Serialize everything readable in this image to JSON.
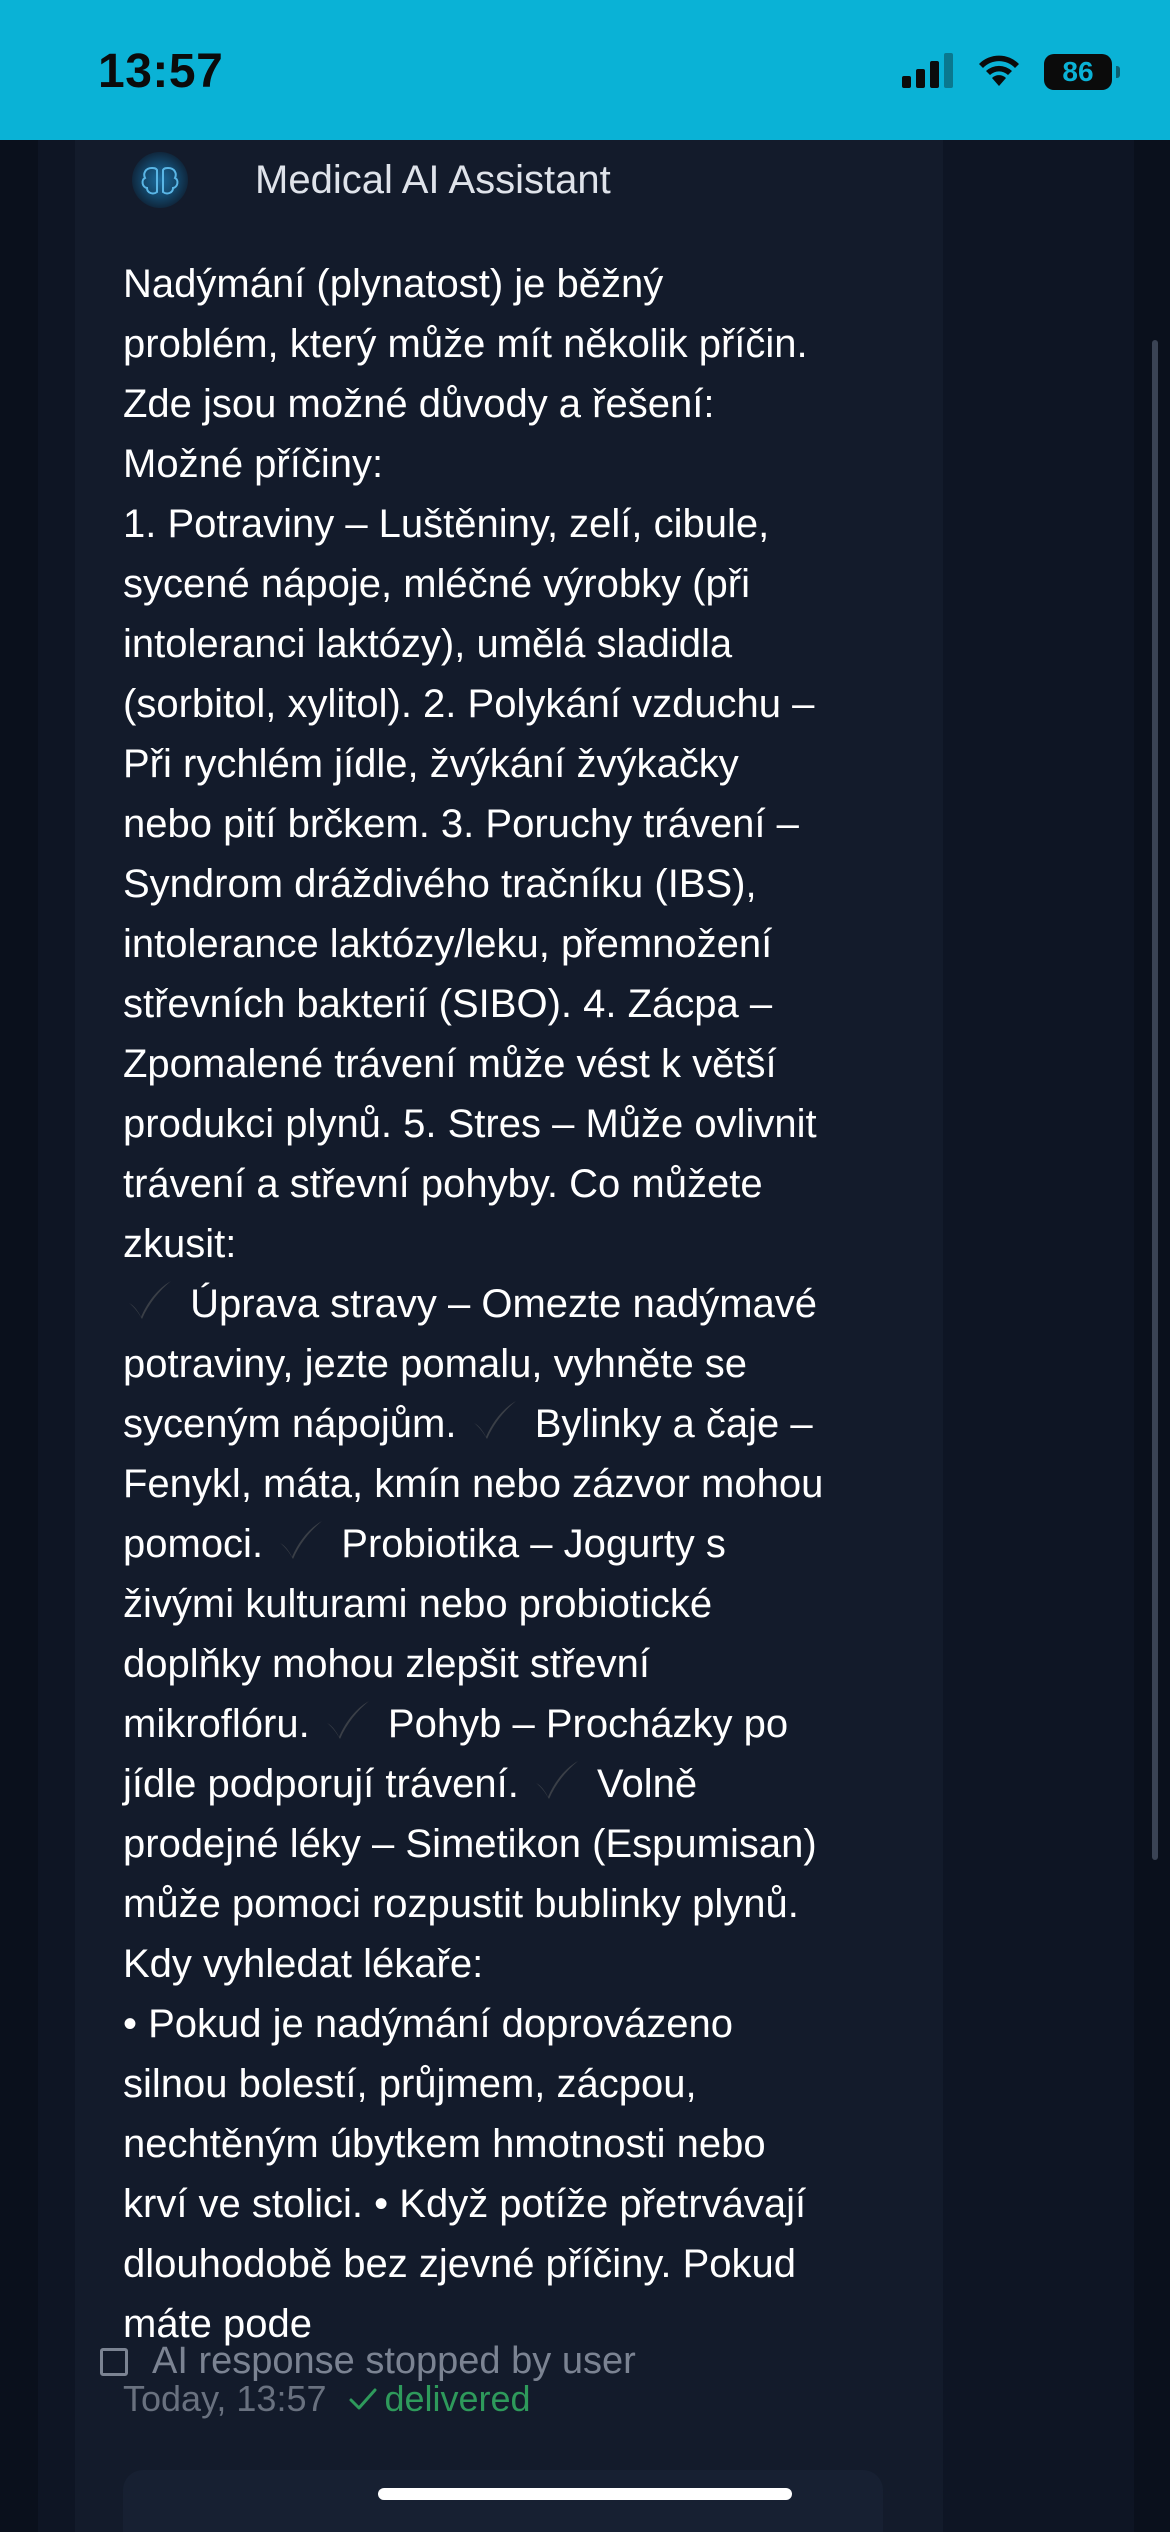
{
  "status_bar": {
    "time": "13:57",
    "battery": "86",
    "background": "#0ab2d6"
  },
  "chat": {
    "sender": "Medical AI Assistant",
    "avatar_icon": "brain-icon",
    "message_lines": [
      "Nadýmání (plynatost) je běžný",
      "problém, který může mít několik příčin.",
      "Zde jsou možné důvody a řešení:",
      "Možné příčiny:",
      "1. Potraviny – Luštěniny, zelí, cibule,",
      "sycené nápoje, mléčné výrobky (při",
      "intoleranci laktózy), umělá sladidla",
      "(sorbitol, xylitol). 2. Polykání vzduchu –",
      "Při rychlém jídle, žvýkání žvýkačky",
      "nebo pití brčkem. 3. Poruchy trávení –",
      "Syndrom dráždivého tračníku (IBS),",
      "intolerance laktózy/leku, přemnožení",
      "střevních bakterií (SIBO). 4. Zácpa –",
      "Zpomalené trávení může vést k větší",
      "produkci plynů. 5. Stres – Může ovlivnit",
      "trávení a střevní pohyby. Co můžete",
      "zkusit:",
      [
        {
          "icon": true
        },
        " Úprava stravy – Omezte nadýmavé"
      ],
      "potraviny, jezte pomalu, vyhněte se",
      [
        "syceným nápojům. ",
        {
          "icon": true
        },
        " Bylinky a čaje –"
      ],
      "Fenykl, máta, kmín nebo zázvor mohou",
      [
        "pomoci. ",
        {
          "icon": true
        },
        " Probiotika – Jogurty s"
      ],
      "živými kulturami nebo probiotické",
      "doplňky mohou zlepšit střevní",
      [
        "mikroflóru. ",
        {
          "icon": true
        },
        " Pohyb – Procházky po"
      ],
      [
        "jídle podporují trávení. ",
        {
          "icon": true
        },
        " Volně"
      ],
      "prodejné léky – Simetikon (Espumisan)",
      "může pomoci rozpustit bublinky plynů.",
      "Kdy vyhledat lékaře:",
      "• Pokud je nadýmání doprovázeno",
      "silnou bolestí, průjmem, zácpou,",
      "nechtěným úbytkem hmotnosti nebo",
      "krví ve stolici. • Když potíže přetrvávají",
      "dlouhodobě bez zjevné příčiny. Pokud",
      "máte pode"
    ],
    "timestamp": "Today, 13:57",
    "delivery_status": "delivered",
    "stopped_notice": "AI response stopped by user"
  },
  "colors": {
    "background": "#0e1524",
    "bubble": "#131b2b",
    "delivered": "#2e9a5b",
    "muted": "#69717f"
  }
}
